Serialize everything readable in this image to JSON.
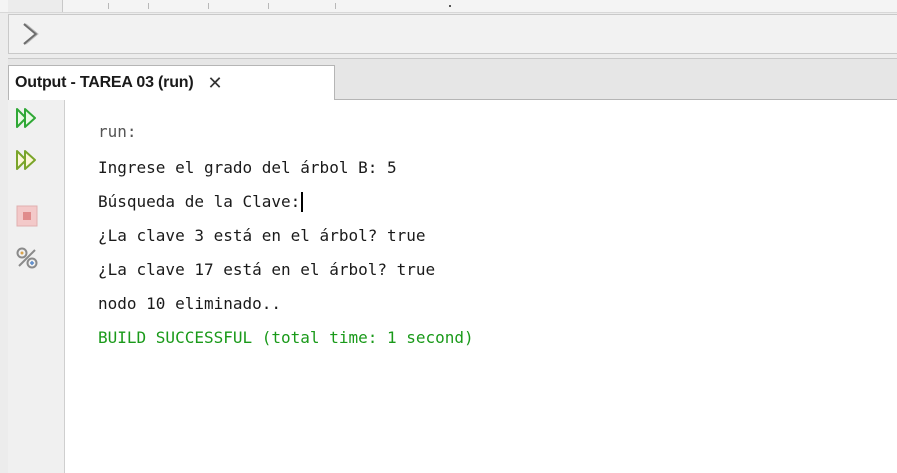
{
  "colors": {
    "success_text": "#1a9a1a",
    "muted_text": "#555555",
    "run_icon": "#2fa836",
    "stop_icon": "#d98a8a"
  },
  "breadcrumb": {
    "icon": "chevron-right-icon"
  },
  "output_panel": {
    "tab_title": "Output - TAREA 03 (run)",
    "close_glyph": "✕"
  },
  "actions": [
    {
      "name": "rerun-button",
      "icon": "double-play-icon"
    },
    {
      "name": "rerun-with-params-button",
      "icon": "double-play-icon"
    },
    {
      "name": "stop-button",
      "icon": "stop-icon"
    },
    {
      "name": "output-settings-button",
      "icon": "settings-wrench-icon"
    }
  ],
  "console": {
    "lines": [
      "run:",
      "Ingrese el grado del árbol B: 5",
      "Búsqueda de la Clave:",
      "¿La clave 3 está en el árbol? true",
      "¿La clave 17 está en el árbol? true",
      "nodo 10 eliminado..",
      "BUILD SUCCESSFUL (total time: 1 second)"
    ]
  }
}
